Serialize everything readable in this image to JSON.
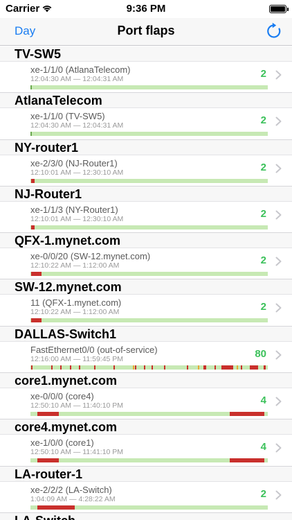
{
  "status_bar": {
    "carrier": "Carrier",
    "time": "9:36 PM"
  },
  "nav": {
    "back_label": "Day",
    "title": "Port flaps"
  },
  "colors": {
    "ok": "#c7e9b4",
    "flap": "#c9302c",
    "warn": "#e7a935",
    "count": "#3cc15b",
    "accent": "#1a7df2"
  },
  "devices": [
    {
      "name": "TV-SW5",
      "port": "xe-1/1/0 (AtlanaTelecom)",
      "range": "12:04:30 AM — 12:04:31 AM",
      "count": "2",
      "segments": [
        {
          "start": 0.0,
          "end": 0.005,
          "color": "#6aa84f"
        }
      ]
    },
    {
      "name": "AtlanaTelecom",
      "port": "xe-1/1/0 (TV-SW5)",
      "range": "12:04:30 AM — 12:04:31 AM",
      "count": "2",
      "segments": [
        {
          "start": 0.0,
          "end": 0.005,
          "color": "#6aa84f"
        }
      ]
    },
    {
      "name": "NY-router1",
      "port": "xe-2/3/0 (NJ-Router1)",
      "range": "12:10:01 AM — 12:30:10 AM",
      "count": "2",
      "segments": [
        {
          "start": 0.003,
          "end": 0.017,
          "color": "#c9302c"
        }
      ]
    },
    {
      "name": "NJ-Router1",
      "port": "xe-1/1/3 (NY-Router1)",
      "range": "12:10:01 AM — 12:30:10 AM",
      "count": "2",
      "segments": [
        {
          "start": 0.003,
          "end": 0.017,
          "color": "#c9302c"
        }
      ]
    },
    {
      "name": "QFX-1.mynet.com",
      "port": "xe-0/0/20 (SW-12.mynet.com)",
      "range": "12:10:22 AM — 1:12:00 AM",
      "count": "2",
      "segments": [
        {
          "start": 0.003,
          "end": 0.047,
          "color": "#c9302c"
        }
      ]
    },
    {
      "name": "SW-12.mynet.com",
      "port": "11 (QFX-1.mynet.com)",
      "range": "12:10:22 AM — 1:12:00 AM",
      "count": "2",
      "segments": [
        {
          "start": 0.003,
          "end": 0.047,
          "color": "#c9302c"
        }
      ]
    },
    {
      "name": "DALLAS-Switch1",
      "port": "FastEthernet0/0 (out-of-service)",
      "range": "12:16:00 AM — 11:59:45 PM",
      "count": "80",
      "segments": [
        {
          "start": 0.003,
          "end": 0.007,
          "color": "#c9302c"
        },
        {
          "start": 0.087,
          "end": 0.092,
          "color": "#c9302c"
        },
        {
          "start": 0.125,
          "end": 0.129,
          "color": "#c9302c"
        },
        {
          "start": 0.165,
          "end": 0.17,
          "color": "#c9302c"
        },
        {
          "start": 0.205,
          "end": 0.21,
          "color": "#c9302c"
        },
        {
          "start": 0.268,
          "end": 0.272,
          "color": "#c9302c"
        },
        {
          "start": 0.35,
          "end": 0.355,
          "color": "#c9302c"
        },
        {
          "start": 0.44,
          "end": 0.445,
          "color": "#c9302c"
        },
        {
          "start": 0.478,
          "end": 0.482,
          "color": "#c9302c"
        },
        {
          "start": 0.51,
          "end": 0.515,
          "color": "#c9302c"
        },
        {
          "start": 0.562,
          "end": 0.566,
          "color": "#c9302c"
        },
        {
          "start": 0.66,
          "end": 0.665,
          "color": "#c9302c"
        },
        {
          "start": 0.73,
          "end": 0.742,
          "color": "#c9302c"
        },
        {
          "start": 0.776,
          "end": 0.781,
          "color": "#c9302c"
        },
        {
          "start": 0.805,
          "end": 0.853,
          "color": "#c9302c"
        },
        {
          "start": 0.887,
          "end": 0.893,
          "color": "#c9302c"
        },
        {
          "start": 0.925,
          "end": 0.96,
          "color": "#c9302c"
        },
        {
          "start": 0.983,
          "end": 0.99,
          "color": "#c9302c"
        },
        {
          "start": 0.432,
          "end": 0.437,
          "color": "#e7a935"
        },
        {
          "start": 0.705,
          "end": 0.71,
          "color": "#e7a935"
        },
        {
          "start": 0.87,
          "end": 0.875,
          "color": "#e7a935"
        }
      ]
    },
    {
      "name": "core1.mynet.com",
      "port": "xe-0/0/0 (core4)",
      "range": "12:50:10 AM — 11:40:10 PM",
      "count": "4",
      "segments": [
        {
          "start": 0.03,
          "end": 0.12,
          "color": "#c9302c"
        },
        {
          "start": 0.84,
          "end": 0.985,
          "color": "#c9302c"
        }
      ]
    },
    {
      "name": "core4.mynet.com",
      "port": "xe-1/0/0 (core1)",
      "range": "12:50:10 AM — 11:41:10 PM",
      "count": "4",
      "segments": [
        {
          "start": 0.03,
          "end": 0.12,
          "color": "#c9302c"
        },
        {
          "start": 0.84,
          "end": 0.985,
          "color": "#c9302c"
        }
      ]
    },
    {
      "name": "LA-router-1",
      "port": "xe-2/2/2 (LA-Switch)",
      "range": "1:04:09 AM — 4:28:22 AM",
      "count": "2",
      "segments": [
        {
          "start": 0.03,
          "end": 0.187,
          "color": "#c9302c"
        }
      ]
    }
  ],
  "partial_section": {
    "name": "LA-Switch"
  }
}
